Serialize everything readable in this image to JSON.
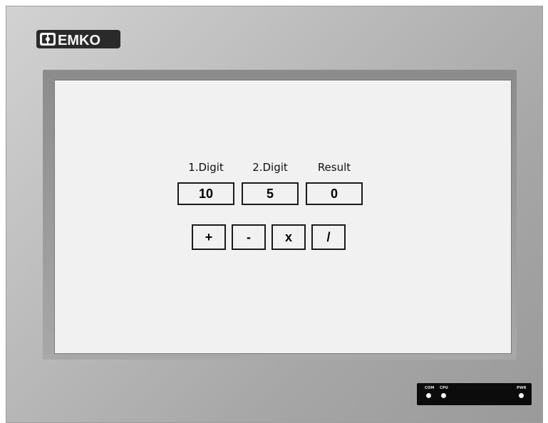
{
  "brand": {
    "logo_text": "EMKO",
    "logo_icon": "emko-logo-icon"
  },
  "calculator": {
    "labels": {
      "digit1": "1.Digit",
      "digit2": "2.Digit",
      "result": "Result"
    },
    "values": {
      "digit1": "10",
      "digit2": "5",
      "result": "0"
    },
    "operators": {
      "add": "+",
      "subtract": "-",
      "multiply": "x",
      "divide": "/"
    }
  },
  "status_panel": {
    "com": "COM",
    "cpu": "CPU",
    "pwr": "PWR"
  }
}
